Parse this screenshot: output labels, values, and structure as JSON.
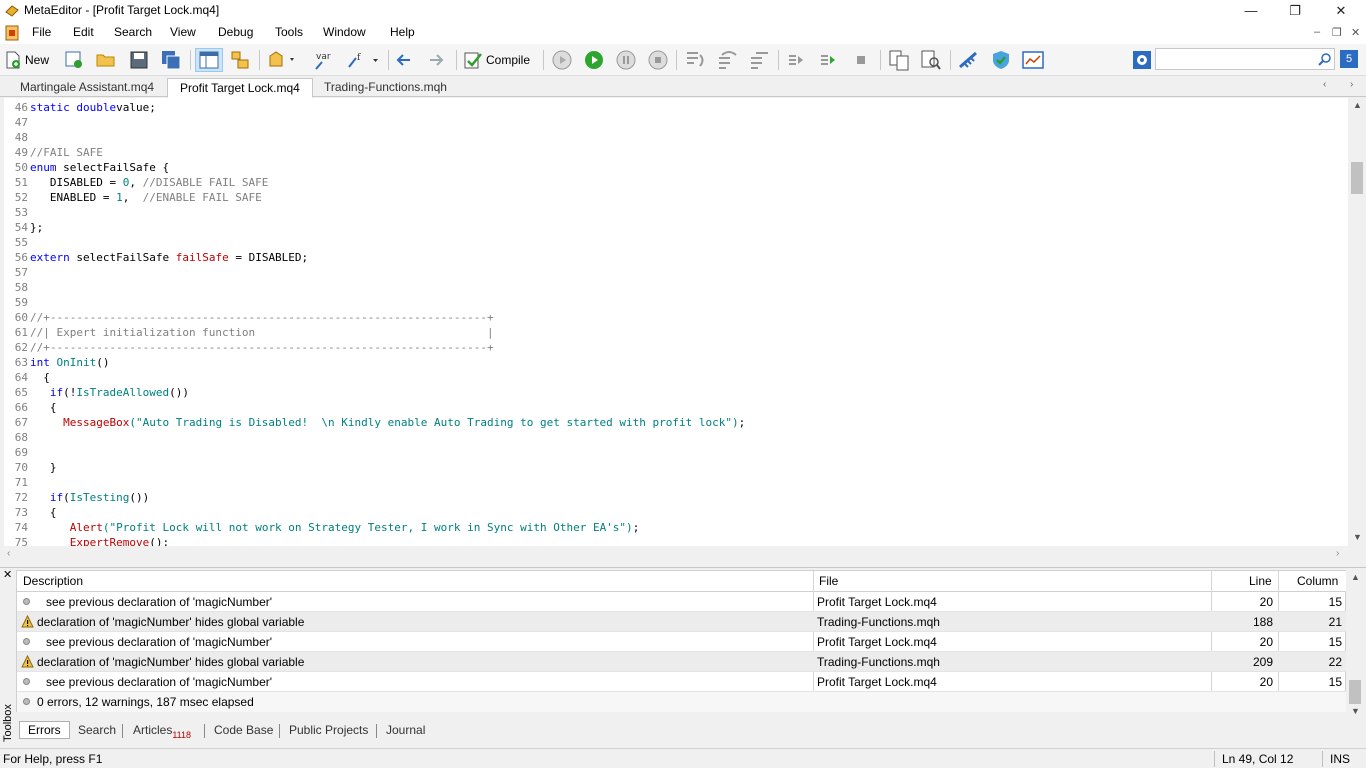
{
  "window": {
    "title": "MetaEditor - [Profit Target Lock.mq4]",
    "minimize": "—",
    "restore": "❐",
    "close": "✕"
  },
  "menu": {
    "items": [
      "File",
      "Edit",
      "Search",
      "View",
      "Debug",
      "Tools",
      "Window",
      "Help"
    ],
    "mdi_min": "–",
    "mdi_restore": "❐",
    "mdi_close": "✕"
  },
  "toolbar": {
    "new_label": "New",
    "compile_label": "Compile",
    "var_label": "var",
    "search_badge": "5"
  },
  "tabs": [
    "Martingale Assistant.mq4",
    "Profit Target Lock.mq4",
    "Trading-Functions.mqh"
  ],
  "active_tab": 1,
  "code": [
    {
      "n": "46",
      "parts": [
        [
          "kw",
          "static double"
        ],
        [
          "",
          "value;"
        ]
      ]
    },
    {
      "n": "47",
      "parts": []
    },
    {
      "n": "48",
      "parts": []
    },
    {
      "n": "49",
      "parts": [
        [
          "cm",
          "//FAIL SAFE"
        ]
      ]
    },
    {
      "n": "50",
      "parts": [
        [
          "kw",
          "enum"
        ],
        [
          "",
          " selectFailSafe {"
        ]
      ]
    },
    {
      "n": "51",
      "parts": [
        [
          "",
          "   DISABLED = "
        ],
        [
          "fn",
          "0"
        ],
        [
          "",
          ", "
        ],
        [
          "cm",
          "//DISABLE FAIL SAFE"
        ]
      ]
    },
    {
      "n": "52",
      "parts": [
        [
          "",
          "   ENABLED = "
        ],
        [
          "fn",
          "1"
        ],
        [
          "",
          ",  "
        ],
        [
          "cm",
          "//ENABLE FAIL SAFE"
        ]
      ]
    },
    {
      "n": "53",
      "parts": []
    },
    {
      "n": "54",
      "parts": [
        [
          "",
          "};"
        ]
      ]
    },
    {
      "n": "55",
      "parts": []
    },
    {
      "n": "56",
      "parts": [
        [
          "kw",
          "extern"
        ],
        [
          "",
          " selectFailSafe "
        ],
        [
          "red",
          "failSafe"
        ],
        [
          "",
          " = DISABLED;"
        ]
      ]
    },
    {
      "n": "57",
      "parts": []
    },
    {
      "n": "58",
      "parts": []
    },
    {
      "n": "59",
      "parts": []
    },
    {
      "n": "60",
      "parts": [
        [
          "cm",
          "//+------------------------------------------------------------------+"
        ]
      ]
    },
    {
      "n": "61",
      "parts": [
        [
          "cm",
          "//| Expert initialization function                                   |"
        ]
      ]
    },
    {
      "n": "62",
      "parts": [
        [
          "cm",
          "//+------------------------------------------------------------------+"
        ]
      ]
    },
    {
      "n": "63",
      "parts": [
        [
          "kw",
          "int"
        ],
        [
          "",
          " "
        ],
        [
          "fn",
          "OnInit"
        ],
        [
          "",
          "()"
        ]
      ]
    },
    {
      "n": "64",
      "parts": [
        [
          "",
          "  {"
        ]
      ]
    },
    {
      "n": "65",
      "parts": [
        [
          "",
          "   "
        ],
        [
          "kw",
          "if"
        ],
        [
          "",
          "(!"
        ],
        [
          "fn",
          "IsTradeAllowed"
        ],
        [
          "",
          "())"
        ]
      ]
    },
    {
      "n": "66",
      "parts": [
        [
          "",
          "   {"
        ]
      ]
    },
    {
      "n": "67",
      "parts": [
        [
          "",
          "     "
        ],
        [
          "red",
          "MessageBox"
        ],
        [
          "str",
          "(\"Auto Trading is Disabled!  \\n Kindly enable Auto Trading to get started with profit lock\")"
        ],
        [
          "",
          ";"
        ]
      ]
    },
    {
      "n": "68",
      "parts": []
    },
    {
      "n": "69",
      "parts": []
    },
    {
      "n": "70",
      "parts": [
        [
          "",
          "   }"
        ]
      ]
    },
    {
      "n": "71",
      "parts": []
    },
    {
      "n": "72",
      "parts": [
        [
          "",
          "   "
        ],
        [
          "kw",
          "if"
        ],
        [
          "",
          "("
        ],
        [
          "fn",
          "IsTesting"
        ],
        [
          "",
          "())"
        ]
      ]
    },
    {
      "n": "73",
      "parts": [
        [
          "",
          "   {"
        ]
      ]
    },
    {
      "n": "74",
      "parts": [
        [
          "",
          "      "
        ],
        [
          "red",
          "Alert"
        ],
        [
          "str",
          "(\"Profit Lock will not work on Strategy Tester, I work in Sync with Other EA's\")"
        ],
        [
          "",
          ";"
        ]
      ]
    },
    {
      "n": "75",
      "parts": [
        [
          "",
          "      "
        ],
        [
          "red",
          "ExpertRemove"
        ],
        [
          "",
          "();"
        ]
      ]
    }
  ],
  "errors": {
    "headers": {
      "description": "Description",
      "file": "File",
      "line": "Line",
      "column": "Column"
    },
    "rows": [
      {
        "type": "info",
        "description": "see previous declaration of 'magicNumber'",
        "file": "Profit Target Lock.mq4",
        "line": "20",
        "column": "15"
      },
      {
        "type": "warning",
        "description": "declaration of 'magicNumber' hides global variable",
        "file": "Trading-Functions.mqh",
        "line": "188",
        "column": "21"
      },
      {
        "type": "info",
        "description": "see previous declaration of 'magicNumber'",
        "file": "Profit Target Lock.mq4",
        "line": "20",
        "column": "15"
      },
      {
        "type": "warning",
        "description": "declaration of 'magicNumber' hides global variable",
        "file": "Trading-Functions.mqh",
        "line": "209",
        "column": "22"
      },
      {
        "type": "info",
        "description": "see previous declaration of 'magicNumber'",
        "file": "Profit Target Lock.mq4",
        "line": "20",
        "column": "15"
      }
    ],
    "summary": "0 errors, 12 warnings, 187 msec elapsed"
  },
  "toolbox": {
    "label": "Toolbox",
    "close": "✕",
    "tabs": [
      "Errors",
      "Search",
      "Articles",
      "Code Base",
      "Public Projects",
      "Journal"
    ],
    "articles_badge": "1118"
  },
  "status": {
    "help": "For Help, press F1",
    "position": "Ln 49, Col 12",
    "mode": "INS"
  }
}
